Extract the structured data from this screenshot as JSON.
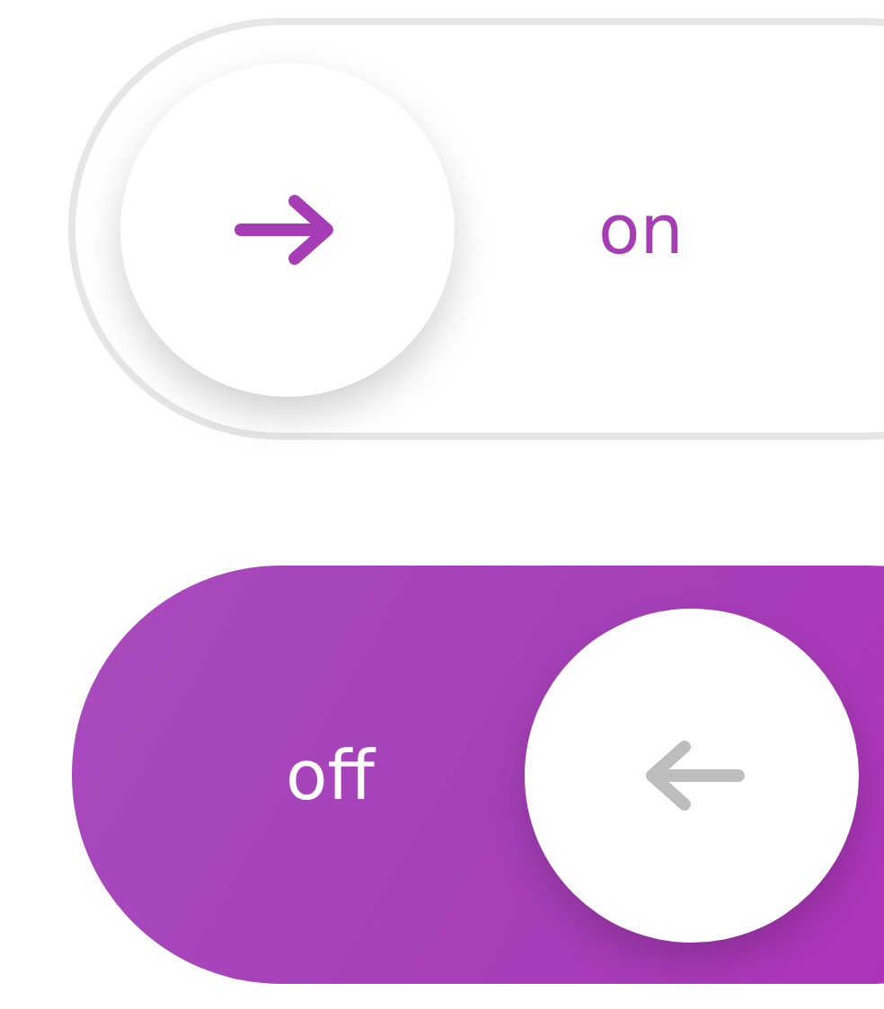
{
  "toggles": [
    {
      "on": false,
      "label": "on"
    },
    {
      "on": true,
      "label": "off"
    }
  ]
}
